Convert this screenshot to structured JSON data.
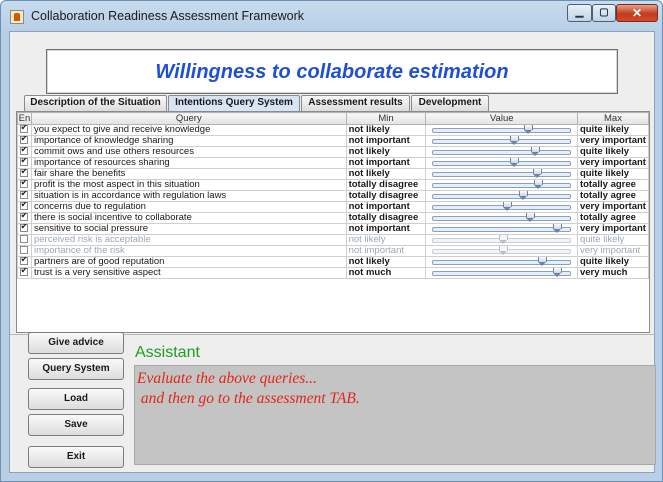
{
  "window": {
    "title": "Collaboration Readiness Assessment Framework"
  },
  "banner": "Willingness to collaborate estimation",
  "tabs": [
    {
      "label": "Description of the Situation",
      "active": false
    },
    {
      "label": "Intentions Query System",
      "active": true
    },
    {
      "label": "Assessment results",
      "active": false
    },
    {
      "label": "Development",
      "active": false
    }
  ],
  "table": {
    "headers": {
      "en": "En",
      "query": "Query",
      "min": "Min",
      "value": "Value",
      "max": "Max"
    },
    "rows": [
      {
        "checked": true,
        "enabled": true,
        "query": "you expect to give and receive knowledge",
        "min": "not likely",
        "max": "quite likely",
        "value": 0.68
      },
      {
        "checked": true,
        "enabled": true,
        "query": "importance of knowledge sharing",
        "min": "not important",
        "max": "very important",
        "value": 0.58
      },
      {
        "checked": true,
        "enabled": true,
        "query": "commit ows and use others resources",
        "min": "not likely",
        "max": "quite likely",
        "value": 0.73
      },
      {
        "checked": true,
        "enabled": true,
        "query": "importance of resources sharing",
        "min": "not important",
        "max": "very important",
        "value": 0.58
      },
      {
        "checked": true,
        "enabled": true,
        "query": "fair share the benefits",
        "min": "not likely",
        "max": "quite likely",
        "value": 0.74
      },
      {
        "checked": true,
        "enabled": true,
        "query": "profit is the most aspect in this situation",
        "min": "totally disagree",
        "max": "totally agree",
        "value": 0.75
      },
      {
        "checked": true,
        "enabled": true,
        "query": "situation is in accordance with regulation laws",
        "min": "totally disagree",
        "max": "totally agree",
        "value": 0.64
      },
      {
        "checked": true,
        "enabled": true,
        "query": "concerns due to regulation",
        "min": "not important",
        "max": "very important",
        "value": 0.53
      },
      {
        "checked": true,
        "enabled": true,
        "query": "there is social incentive to collaborate",
        "min": "totally disagree",
        "max": "totally agree",
        "value": 0.69
      },
      {
        "checked": true,
        "enabled": true,
        "query": "sensitive to social pressure",
        "min": "not important",
        "max": "very important",
        "value": 0.88
      },
      {
        "checked": false,
        "enabled": false,
        "query": "perceived risk is acceptable",
        "min": "not likely",
        "max": "quite likely",
        "value": 0.5
      },
      {
        "checked": false,
        "enabled": false,
        "query": "importance of the risk",
        "min": "not important",
        "max": "very important",
        "value": 0.5
      },
      {
        "checked": true,
        "enabled": true,
        "query": "partners are of good reputation",
        "min": "not likely",
        "max": "quite likely",
        "value": 0.78
      },
      {
        "checked": true,
        "enabled": true,
        "query": "trust is a very sensitive aspect",
        "min": "not much",
        "max": "very much",
        "value": 0.88
      }
    ]
  },
  "buttons": {
    "give_advice": "Give advice",
    "query_system": "Query System",
    "load": "Load",
    "save": "Save",
    "exit": "Exit"
  },
  "assistant": {
    "label": "Assistant",
    "line1": "Evaluate the above queries...",
    "line2": " and then go to the assessment TAB."
  },
  "colors": {
    "banner_text": "#1f4fd8",
    "assistant_label": "#1f9d1f",
    "assistant_text": "#e0261a",
    "assistant_bg": "#c4c4c4"
  },
  "icons": [
    "java-cup-icon",
    "minimize-icon",
    "maximize-icon",
    "close-icon",
    "checkbox-icon",
    "slider-thumb-icon"
  ]
}
